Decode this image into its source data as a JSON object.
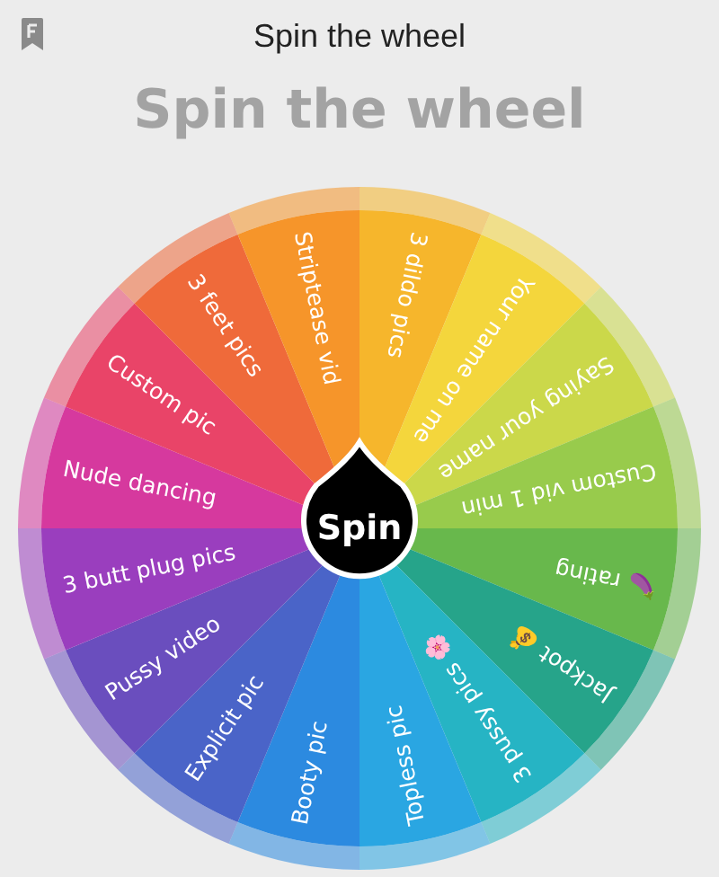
{
  "header": {
    "title": "Spin the wheel"
  },
  "heading": "Spin the wheel",
  "wheel": {
    "button": "Spin",
    "segments": [
      {
        "label": "3 dildo pics",
        "color": "#f6b62c"
      },
      {
        "label": "Your name on me",
        "color": "#f4d63c"
      },
      {
        "label": "Saying your name",
        "color": "#cbd84a"
      },
      {
        "label": "Custom vid 1 min",
        "color": "#98cb4c"
      },
      {
        "label": "🍆 rating",
        "color": "#68b84c"
      },
      {
        "label": "Jackpot 💰",
        "color": "#26a48a"
      },
      {
        "label": "3 pussy pics 🌸",
        "color": "#26b4c4"
      },
      {
        "label": "Topless pic",
        "color": "#2aa6e2"
      },
      {
        "label": "Booty pic",
        "color": "#2c8ae0"
      },
      {
        "label": "Explicit pic",
        "color": "#4a64c8"
      },
      {
        "label": "Pussy video",
        "color": "#6a4ebe"
      },
      {
        "label": "3 butt plug pics",
        "color": "#9a3ebe"
      },
      {
        "label": "Nude dancing",
        "color": "#d6399e"
      },
      {
        "label": "Custom pic",
        "color": "#e94468"
      },
      {
        "label": "3 feet pics",
        "color": "#ef6a3a"
      },
      {
        "label": "Striptease vid",
        "color": "#f6952a"
      }
    ]
  }
}
